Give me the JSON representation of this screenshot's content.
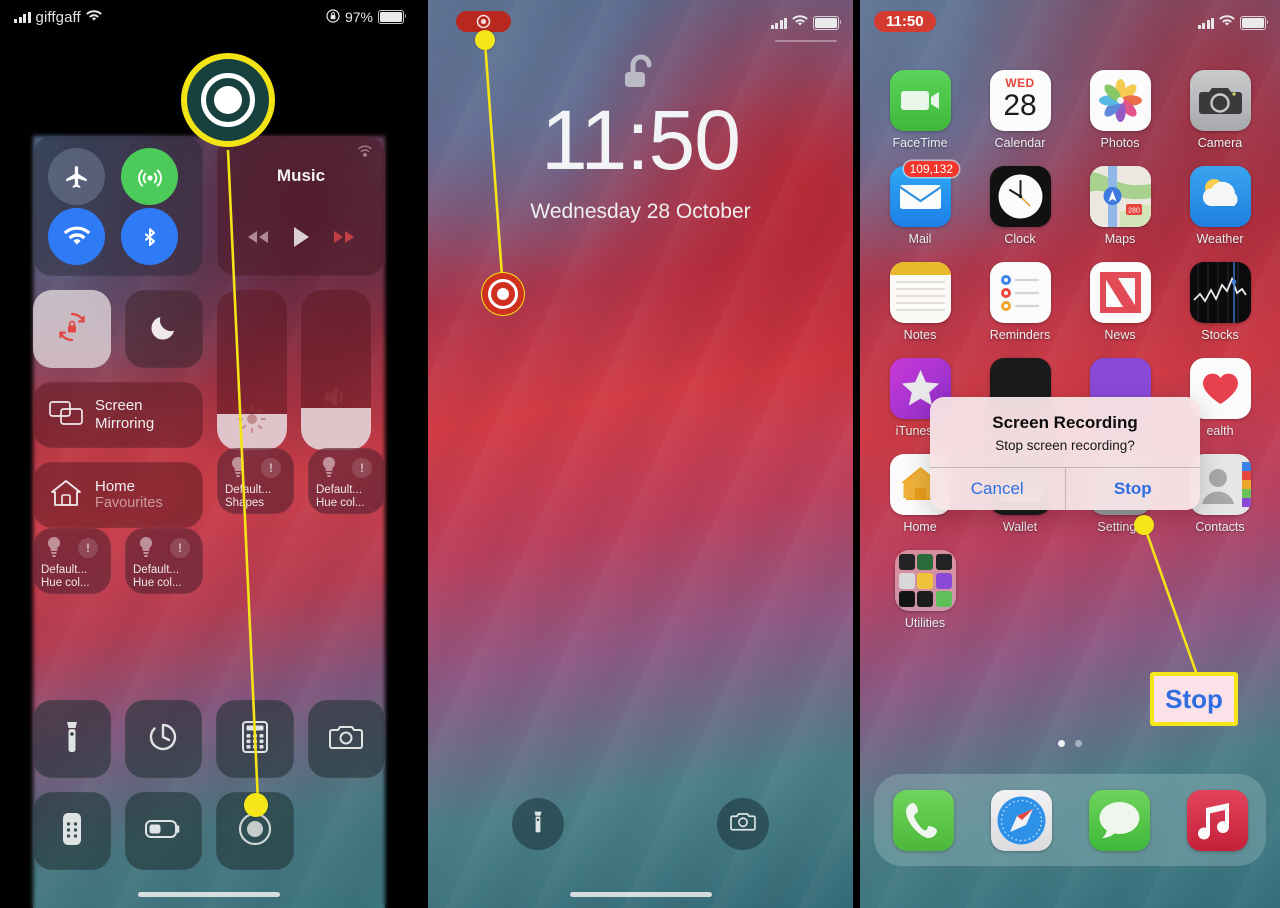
{
  "panels": {
    "control_center": {
      "status": {
        "carrier": "giffgaff",
        "battery_pct": "97%",
        "signal_icon": "signal-bars-icon",
        "wifi_icon": "wifi-icon",
        "rotation_lock_icon": "rotation-lock-icon",
        "battery_icon": "battery-icon"
      },
      "connectivity": {
        "airplane_icon": "airplane-mode-icon",
        "cellular_icon": "cellular-data-icon",
        "wifi_icon": "wifi-icon",
        "bluetooth_icon": "bluetooth-icon"
      },
      "music": {
        "title": "Music",
        "prev_icon": "rewind-icon",
        "play_icon": "play-icon",
        "next_icon": "fast-forward-icon",
        "airplay_icon": "airplay-icon"
      },
      "toggles": {
        "rotation_lock_icon": "rotation-lock-icon",
        "do_not_disturb_icon": "moon-icon"
      },
      "sliders": {
        "brightness_icon": "brightness-icon",
        "volume_icon": "speaker-icon",
        "brightness_value": 22,
        "volume_value": 26
      },
      "screen_mirroring": {
        "label": "Screen Mirroring",
        "icon": "screen-mirroring-icon"
      },
      "home": {
        "label": "Home",
        "sublabel": "Favourites",
        "icon": "home-icon"
      },
      "hue_tiles": [
        {
          "line1": "Default...",
          "line2": "Shapes",
          "icon": "bulb-icon",
          "badge": "!"
        },
        {
          "line1": "Default...",
          "line2": "Hue col...",
          "icon": "bulb-icon",
          "badge": "!"
        },
        {
          "line1": "Default...",
          "line2": "Hue col...",
          "icon": "bulb-icon",
          "badge": "!"
        },
        {
          "line1": "Default...",
          "line2": "Hue col...",
          "icon": "bulb-icon",
          "badge": "!"
        }
      ],
      "bottom_tiles": [
        {
          "name": "flashlight-icon"
        },
        {
          "name": "timer-icon"
        },
        {
          "name": "calculator-icon"
        },
        {
          "name": "camera-icon"
        },
        {
          "name": "apple-tv-remote-icon"
        },
        {
          "name": "low-power-mode-icon"
        },
        {
          "name": "screen-record-icon"
        }
      ],
      "highlight_record_icon": "screen-record-icon"
    },
    "lock_screen": {
      "recording_pill_icon": "screen-record-active-icon",
      "lock_icon": "unlocked-padlock-icon",
      "time": "11:50",
      "date": "Wednesday 28 October",
      "torch_icon": "flashlight-icon",
      "camera_icon": "camera-icon",
      "status": {
        "signal_icon": "signal-bars-icon",
        "wifi_icon": "wifi-icon",
        "battery_icon": "battery-icon"
      }
    },
    "home_screen": {
      "time_pill": "11:50",
      "status": {
        "signal_icon": "signal-bars-icon",
        "wifi_icon": "wifi-icon",
        "battery_icon": "battery-icon"
      },
      "rows": [
        [
          {
            "label": "FaceTime",
            "icon": "facetime-icon"
          },
          {
            "label": "Calendar",
            "icon": "calendar-icon",
            "weekday": "WED",
            "day": "28"
          },
          {
            "label": "Photos",
            "icon": "photos-icon"
          },
          {
            "label": "Camera",
            "icon": "camera-icon"
          }
        ],
        [
          {
            "label": "Mail",
            "icon": "mail-icon",
            "badge": "109,132"
          },
          {
            "label": "Clock",
            "icon": "clock-icon"
          },
          {
            "label": "Maps",
            "icon": "maps-icon",
            "shield": "280"
          },
          {
            "label": "Weather",
            "icon": "weather-icon"
          }
        ],
        [
          {
            "label": "Notes",
            "icon": "notes-icon"
          },
          {
            "label": "Reminders",
            "icon": "reminders-icon"
          },
          {
            "label": "News",
            "icon": "news-icon"
          },
          {
            "label": "Stocks",
            "icon": "stocks-icon"
          }
        ],
        [
          {
            "label": "iTunes S",
            "icon": "itunes-store-icon"
          },
          {
            "label": "",
            "icon": "tv-icon"
          },
          {
            "label": "",
            "icon": "podcasts-icon"
          },
          {
            "label": "ealth",
            "icon": "health-icon"
          }
        ],
        [
          {
            "label": "Home",
            "icon": "home-app-icon"
          },
          {
            "label": "Wallet",
            "icon": "wallet-icon"
          },
          {
            "label": "Settings",
            "icon": "settings-icon"
          },
          {
            "label": "Contacts",
            "icon": "contacts-icon"
          }
        ],
        [
          {
            "label": "Utilities",
            "icon": "utilities-folder-icon"
          }
        ]
      ],
      "dock": [
        {
          "label": "Phone",
          "icon": "phone-icon"
        },
        {
          "label": "Safari",
          "icon": "safari-icon"
        },
        {
          "label": "Messages",
          "icon": "messages-icon"
        },
        {
          "label": "Music",
          "icon": "music-icon"
        }
      ],
      "alert": {
        "title": "Screen Recording",
        "message": "Stop screen recording?",
        "cancel_label": "Cancel",
        "stop_label": "Stop"
      }
    }
  },
  "annotations": {
    "callout_stop_label": "Stop",
    "highlight_color": "#f3e317",
    "callout_bg": "#fbe2e8",
    "callout_text_color": "#2f6ee0"
  }
}
